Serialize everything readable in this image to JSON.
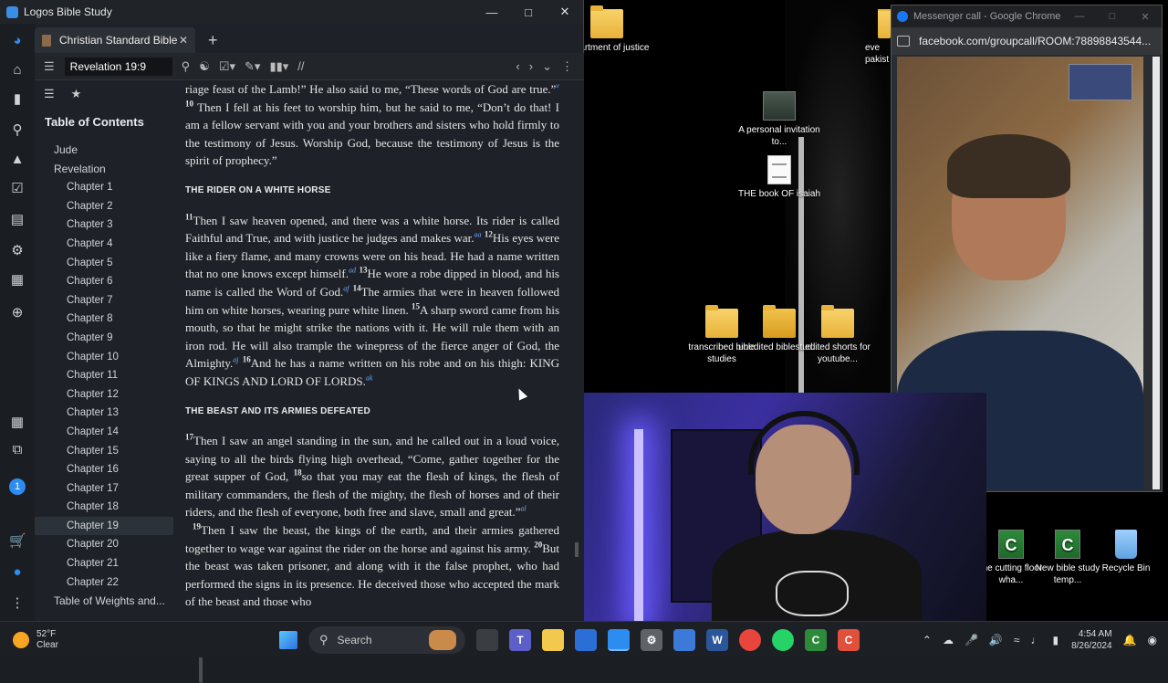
{
  "logos": {
    "window_title": "Logos Bible Study",
    "tab_label": "Christian Standard Bible",
    "reference": "Revelation 19:9",
    "toc_title": "Table of Contents",
    "toc_items": [
      {
        "label": "Jude",
        "level": "book"
      },
      {
        "label": "Revelation",
        "level": "book"
      },
      {
        "label": "Chapter 1",
        "level": "chapter"
      },
      {
        "label": "Chapter 2",
        "level": "chapter"
      },
      {
        "label": "Chapter 3",
        "level": "chapter"
      },
      {
        "label": "Chapter 4",
        "level": "chapter"
      },
      {
        "label": "Chapter 5",
        "level": "chapter"
      },
      {
        "label": "Chapter 6",
        "level": "chapter"
      },
      {
        "label": "Chapter 7",
        "level": "chapter"
      },
      {
        "label": "Chapter 8",
        "level": "chapter"
      },
      {
        "label": "Chapter 9",
        "level": "chapter"
      },
      {
        "label": "Chapter 10",
        "level": "chapter"
      },
      {
        "label": "Chapter 11",
        "level": "chapter"
      },
      {
        "label": "Chapter 12",
        "level": "chapter"
      },
      {
        "label": "Chapter 13",
        "level": "chapter"
      },
      {
        "label": "Chapter 14",
        "level": "chapter"
      },
      {
        "label": "Chapter 15",
        "level": "chapter"
      },
      {
        "label": "Chapter 16",
        "level": "chapter"
      },
      {
        "label": "Chapter 17",
        "level": "chapter"
      },
      {
        "label": "Chapter 18",
        "level": "chapter"
      },
      {
        "label": "Chapter 19",
        "level": "chapter",
        "selected": true
      },
      {
        "label": "Chapter 20",
        "level": "chapter"
      },
      {
        "label": "Chapter 21",
        "level": "chapter"
      },
      {
        "label": "Chapter 22",
        "level": "chapter"
      },
      {
        "label": "Table of Weights and...",
        "level": "book"
      }
    ],
    "rail_badge": "1",
    "passage": {
      "p1": "riage feast of the Lamb!” He also said to me, “These words of God are true.”",
      "v10_num": "10",
      "v10": "Then I fell at his feet to worship him, but he said to me, “Don’t do that! I am a fellow servant with you and your brothers and sisters who hold firmly to the testimony of Jesus. Worship God, because the testimony of Jesus is the spirit of prophecy.”",
      "h1": "THE RIDER ON A WHITE HORSE",
      "v11_num": "11",
      "v11": "Then I saw heaven opened, and there was a white horse. Its rider is called Faithful and True, and with justice he judges and makes war.",
      "v12_num": "12",
      "v12": "His eyes were like a fiery flame, and many crowns were on his head. He had a name written that no one knows except himself.",
      "v13_num": "13",
      "v13": "He wore a robe dipped in blood, and his name is called the Word of God.",
      "v14_num": "14",
      "v14": "The armies that were in heaven followed him on white horses, wearing pure white linen.",
      "v15_num": "15",
      "v15": "A sharp sword came from his mouth, so that he might strike the nations with it. He will rule them with an iron rod. He will also trample the winepress of the fierce anger of God, the Almighty.",
      "v16_num": "16",
      "v16": "And he has a name written on his robe and on his thigh: KING OF KINGS AND LORD OF LORDS.",
      "h2": "THE BEAST AND ITS ARMIES DEFEATED",
      "v17_num": "17",
      "v17": "Then I saw an angel standing in the sun, and he called out in a loud voice, saying to all the birds flying high overhead, “Come, gather together for the great supper of God,",
      "v18_num": "18",
      "v18": "so that you may eat the flesh of kings, the flesh of military commanders, the flesh of the mighty, the flesh of horses and of their riders, and the flesh of everyone, both free and slave, small and great.”",
      "v19_num": "19",
      "v19": "Then I saw the beast, the kings of the earth, and their armies gathered together to wage war against the rider on the horse and against his army.",
      "v20_num": "20",
      "v20": "But the beast was taken prisoner, and along with it the false prophet, who had performed the signs in its presence. He deceived those who accepted the mark of the beast and those who"
    }
  },
  "chrome": {
    "title": "Messenger call - Google Chrome",
    "url": "facebook.com/groupcall/ROOM:78898843544..."
  },
  "desktop_icons": [
    {
      "label": "department of justice",
      "kind": "chrome"
    },
    {
      "label": "A personal invitation to...",
      "kind": "video"
    },
    {
      "label": "THE book OF isaiah",
      "kind": "doc"
    },
    {
      "label": "transcribed bible studies",
      "kind": "folder"
    },
    {
      "label": "unedited biblestud...",
      "kind": "folder-dark"
    },
    {
      "label": "edited shorts for youtube...",
      "kind": "folder"
    },
    {
      "label": "the cutting floor wha...",
      "kind": "camtasia"
    },
    {
      "label": "New bible study temp...",
      "kind": "camtasia"
    },
    {
      "label": "Recycle Bin",
      "kind": "bin"
    },
    {
      "label": "eve pakist",
      "kind": "partial"
    }
  ],
  "taskbar": {
    "temperature": "52°F",
    "condition": "Clear",
    "search_placeholder": "Search",
    "time": "4:54 AM",
    "date": "8/26/2024"
  },
  "colors": {
    "accent": "#2d8cf0",
    "footnote": "#6aa8ff",
    "bg": "#1e2228"
  }
}
